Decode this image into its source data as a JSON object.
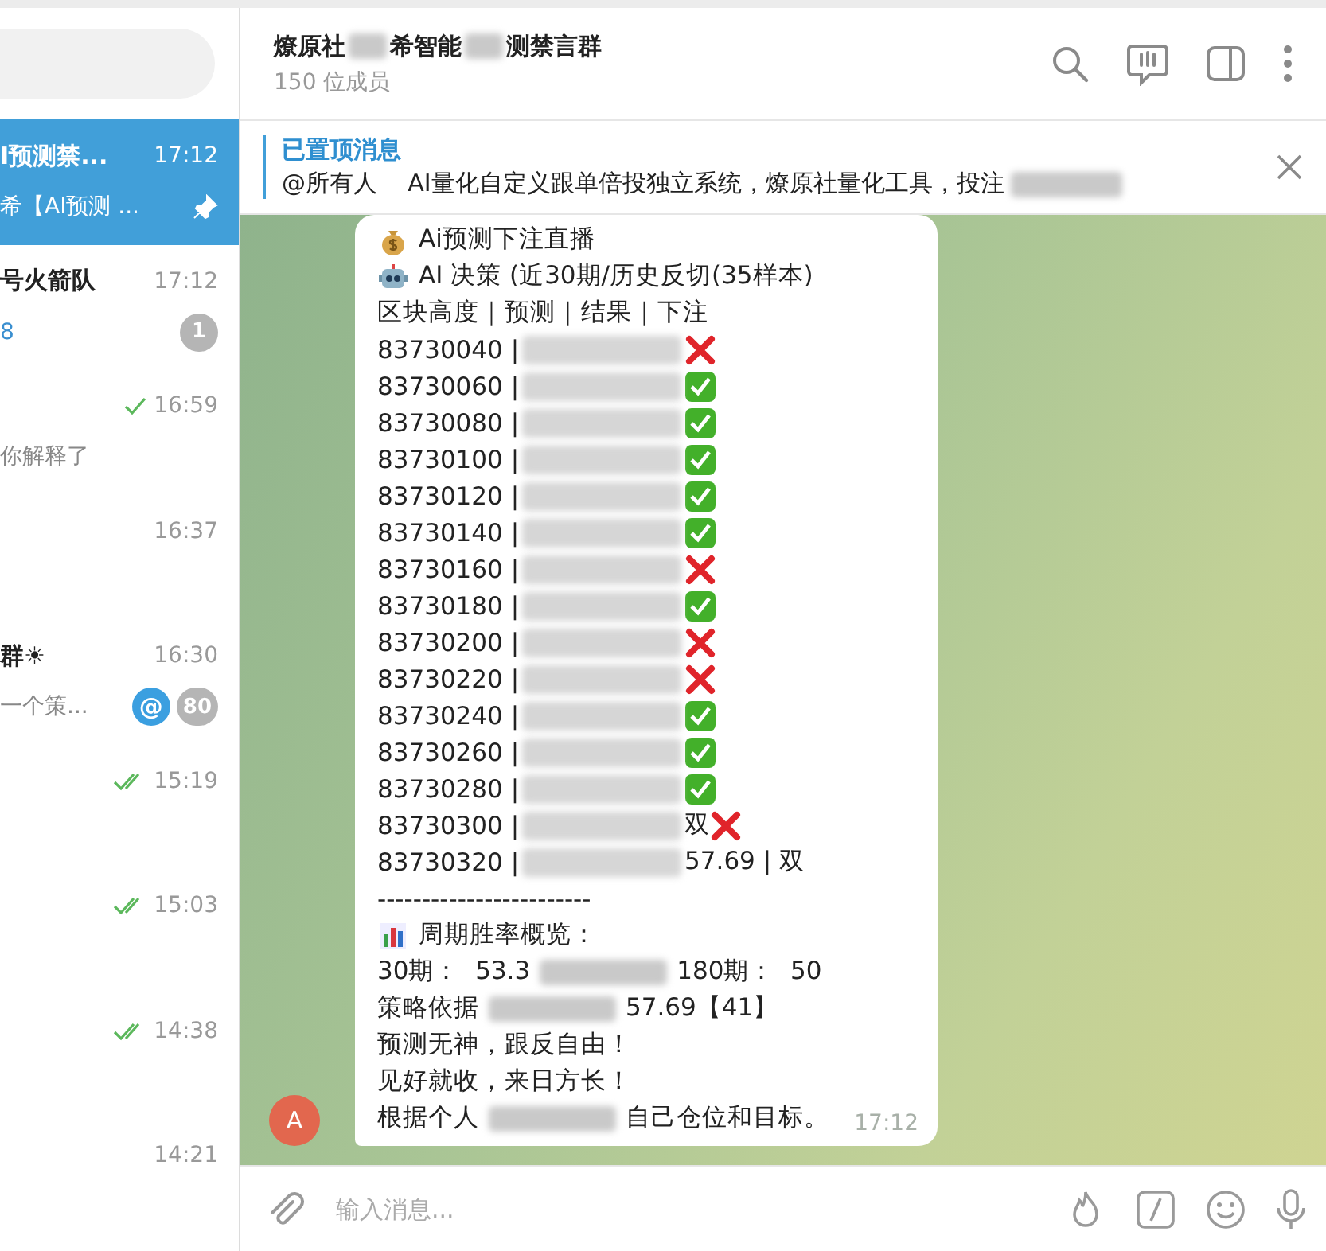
{
  "sidebar": {
    "chats": [
      {
        "title": "I预测禁...",
        "time": "17:12",
        "preview": "希【AI预测 ...",
        "selected": true,
        "pinned": true,
        "preview_accent": false,
        "sent": false,
        "read": false
      },
      {
        "title": "号火箭队",
        "time": "17:12",
        "preview": "8",
        "selected": false,
        "pinned": false,
        "preview_accent": true,
        "unread": "1",
        "sent": false,
        "read": false
      },
      {
        "time": "16:59",
        "preview": "你解释了",
        "selected": false,
        "pinned": false,
        "preview_accent": false,
        "sent": true,
        "read": false
      },
      {
        "time": "16:37",
        "selected": false,
        "pinned": false,
        "sent": false,
        "read": false
      },
      {
        "title": "群☀",
        "time": "16:30",
        "preview": "一个策...",
        "selected": false,
        "pinned": false,
        "preview_accent": false,
        "mention": "@",
        "unread": "80",
        "sent": false,
        "read": false
      },
      {
        "time": "15:19",
        "selected": false,
        "pinned": false,
        "sent": true,
        "read": true
      },
      {
        "time": "15:03",
        "selected": false,
        "pinned": false,
        "sent": true,
        "read": true
      },
      {
        "time": "14:38",
        "selected": false,
        "pinned": false,
        "sent": true,
        "read": true
      },
      {
        "time": "14:21",
        "selected": false,
        "pinned": false,
        "sent": false,
        "read": false
      }
    ]
  },
  "chat": {
    "title_parts": [
      "燎原社",
      "希智能",
      "测禁言群"
    ],
    "members": "150 位成员",
    "pinned": {
      "label": "已置顶消息",
      "text": "@所有人    AI量化自定义跟单倍投独立系统，燎原社量化工具，投注"
    },
    "message": {
      "avatar": "A",
      "time": "17:12",
      "lines": [
        {
          "kind": "bag",
          "parts": [
            "Ai预测下注直播"
          ]
        },
        {
          "kind": "robot",
          "parts": [
            "AI 决策 (近30期/历史反切(35样本)"
          ]
        },
        {
          "kind": "text",
          "parts": [
            "区块高度｜预测｜结果｜下注"
          ]
        },
        {
          "kind": "row",
          "parts": [
            "83730040 |"
          ],
          "hit": false
        },
        {
          "kind": "row",
          "parts": [
            "83730060 |"
          ],
          "hit": true
        },
        {
          "kind": "row",
          "parts": [
            "83730080 |"
          ],
          "hit": true
        },
        {
          "kind": "row",
          "parts": [
            "83730100 |"
          ],
          "hit": true
        },
        {
          "kind": "row",
          "parts": [
            "83730120 |"
          ],
          "hit": true
        },
        {
          "kind": "row",
          "parts": [
            "83730140 |"
          ],
          "hit": true
        },
        {
          "kind": "row",
          "parts": [
            "83730160 |"
          ],
          "hit": false
        },
        {
          "kind": "row",
          "parts": [
            "83730180 |"
          ],
          "hit": true
        },
        {
          "kind": "row",
          "parts": [
            "83730200 |"
          ],
          "hit": false
        },
        {
          "kind": "row",
          "parts": [
            "83730220 |"
          ],
          "hit": false
        },
        {
          "kind": "row",
          "parts": [
            "83730240 |"
          ],
          "hit": true
        },
        {
          "kind": "row",
          "parts": [
            "83730260 |"
          ],
          "hit": true
        },
        {
          "kind": "row",
          "parts": [
            "83730280 |"
          ],
          "hit": true
        },
        {
          "kind": "row",
          "parts": [
            "83730300 |",
            "双"
          ],
          "hit": false
        },
        {
          "kind": "row",
          "parts": [
            "83730320 |",
            "57.69 | 双"
          ]
        },
        {
          "kind": "text",
          "parts": [
            "------------------------"
          ]
        },
        {
          "kind": "chart",
          "parts": [
            "周期胜率概览："
          ]
        },
        {
          "kind": "text",
          "parts": [
            "30期：  53.3",
            "180期：  50"
          ]
        },
        {
          "kind": "text",
          "parts": [
            "策略依据",
            "57.69【41】"
          ]
        },
        {
          "kind": "text",
          "parts": [
            "预测无神，跟反自由！"
          ]
        },
        {
          "kind": "text",
          "parts": [
            "见好就收，来日方长！"
          ]
        },
        {
          "kind": "text",
          "parts": [
            "根据个人",
            "自己仓位和目标。"
          ]
        }
      ]
    }
  },
  "composer": {
    "placeholder": "输入消息..."
  }
}
